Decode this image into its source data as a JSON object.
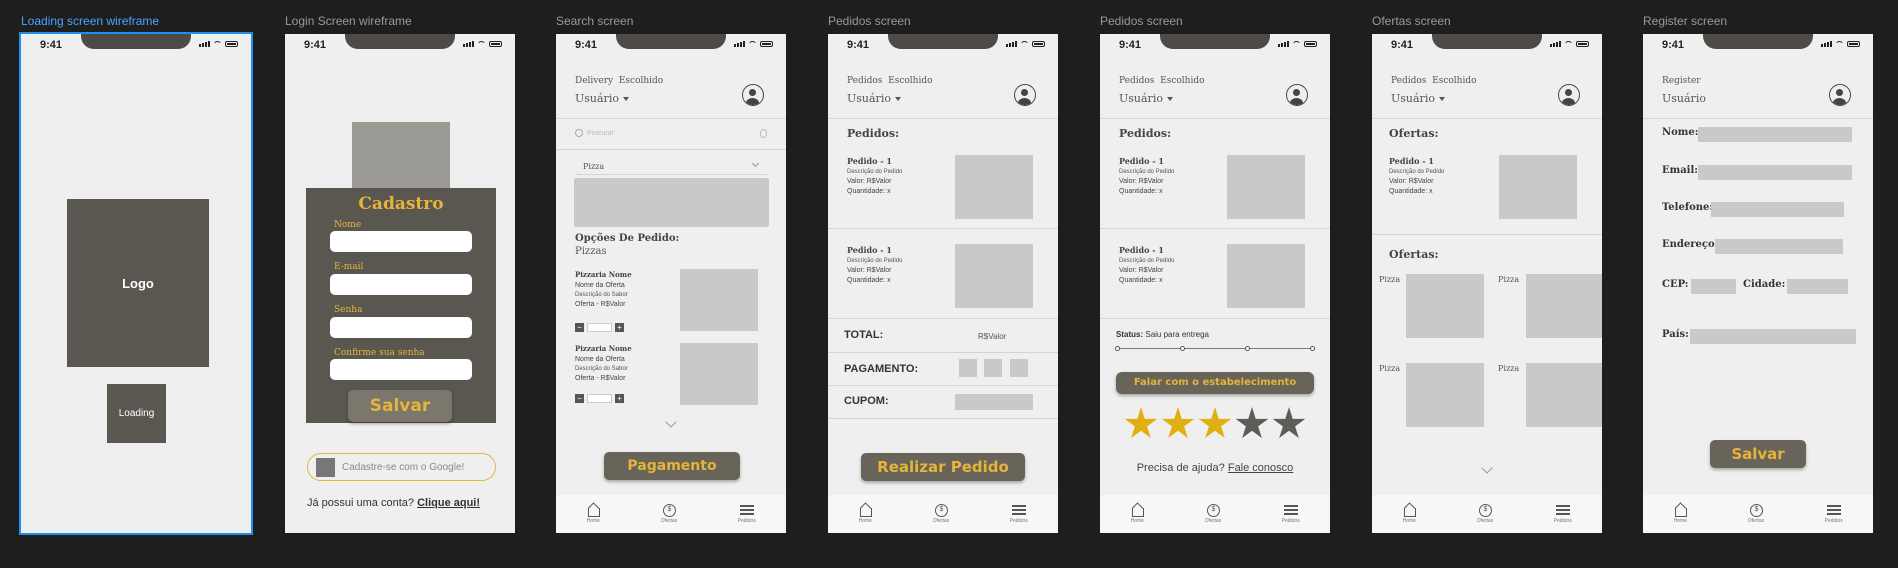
{
  "frames": {
    "loading": {
      "title": "Loading screen wireframe",
      "logo": "Logo",
      "loading": "Loading"
    },
    "login": {
      "title": "Login Screen wireframe",
      "heading": "Cadastro",
      "name_label": "Nome",
      "email_label": "E-mail",
      "password_label": "Senha",
      "confirm_label": "Confirme sua senha",
      "save": "Salvar",
      "google": "Cadastre-se com o Google!",
      "have_account": "Já possui uma conta?",
      "click_here": "Clique aqui!"
    },
    "search": {
      "title": "Search screen",
      "nav1": "Delivery",
      "nav2": "Escolhido",
      "user": "Usuário",
      "search_placeholder": "Procurar",
      "dropdown": "Pizza",
      "options_title": "Opções De Pedido:",
      "options_sub": "Pizzas",
      "items": [
        {
          "name": "Pizzaria Nome",
          "offer": "Nome da Oferta",
          "desc": "Descrição do Sabor",
          "price": "Oferta - R$Valor"
        },
        {
          "name": "Pizzaria Nome",
          "offer": "Nome da Oferta",
          "desc": "Descrição do Sabor",
          "price": "Oferta - R$Valor"
        }
      ],
      "button": "Pagamento"
    },
    "pedidos1": {
      "title": "Pedidos screen",
      "nav1": "Pedidos",
      "nav2": "Escolhido",
      "user": "Usuário",
      "section": "Pedidos:",
      "orders": [
        {
          "name": "Pedido - 1",
          "desc": "Descrição do Pedido",
          "value": "Valor: R$Valor",
          "qty": "Quantidade: x"
        },
        {
          "name": "Pedido - 1",
          "desc": "Descrição do Pedido",
          "value": "Valor: R$Valor",
          "qty": "Quantidade: x"
        }
      ],
      "total_label": "TOTAL:",
      "total_value": "R$Valor",
      "payment_label": "PAGAMENTO:",
      "coupon_label": "CUPOM:",
      "button": "Realizar Pedido"
    },
    "pedidos2": {
      "title": "Pedidos screen",
      "nav1": "Pedidos",
      "nav2": "Escolhido",
      "user": "Usuário",
      "section": "Pedidos:",
      "orders": [
        {
          "name": "Pedido - 1",
          "desc": "Descrição do Pedido",
          "value": "Valor: R$Valor",
          "qty": "Quantidade: x"
        },
        {
          "name": "Pedido - 1",
          "desc": "Descrição do Pedido",
          "value": "Valor: R$Valor",
          "qty": "Quantidade: x"
        }
      ],
      "status_label": "Status:",
      "status_value": "Saiu para entrega",
      "contact_button": "Falar com o estabelecimento",
      "rating": 3,
      "rating_max": 5,
      "help": "Precisa de ajuda?",
      "contact_link": "Fale conosco"
    },
    "ofertas": {
      "title": "Ofertas screen",
      "nav1": "Pedidos",
      "nav2": "Escolhido",
      "user": "Usuário",
      "section": "Ofertas:",
      "order": {
        "name": "Pedido - 1",
        "desc": "Descrição do Pedido",
        "value": "Valor: R$Valor",
        "qty": "Quantidade: x"
      },
      "section2": "Ofertas:",
      "tiles": [
        "Pizza",
        "Pizza",
        "Pizza",
        "Pizza"
      ]
    },
    "register": {
      "title": "Register screen",
      "nav1": "Register",
      "user": "Usuário",
      "name": "Nome:",
      "email": "Email:",
      "phone": "Telefone:",
      "address": "Endereço:",
      "cep": "CEP:",
      "city": "Cidade:",
      "country": "País:",
      "save": "Salvar"
    }
  },
  "status_time": "9:41",
  "tabs": [
    "Home",
    "Ofertas",
    "Pedidos"
  ],
  "colors": {
    "dark": "#5a5750",
    "gold": "#e6b43a",
    "star_on": "#e0b012",
    "star_off": "#5e5c58",
    "selection": "#1e8ff0"
  }
}
